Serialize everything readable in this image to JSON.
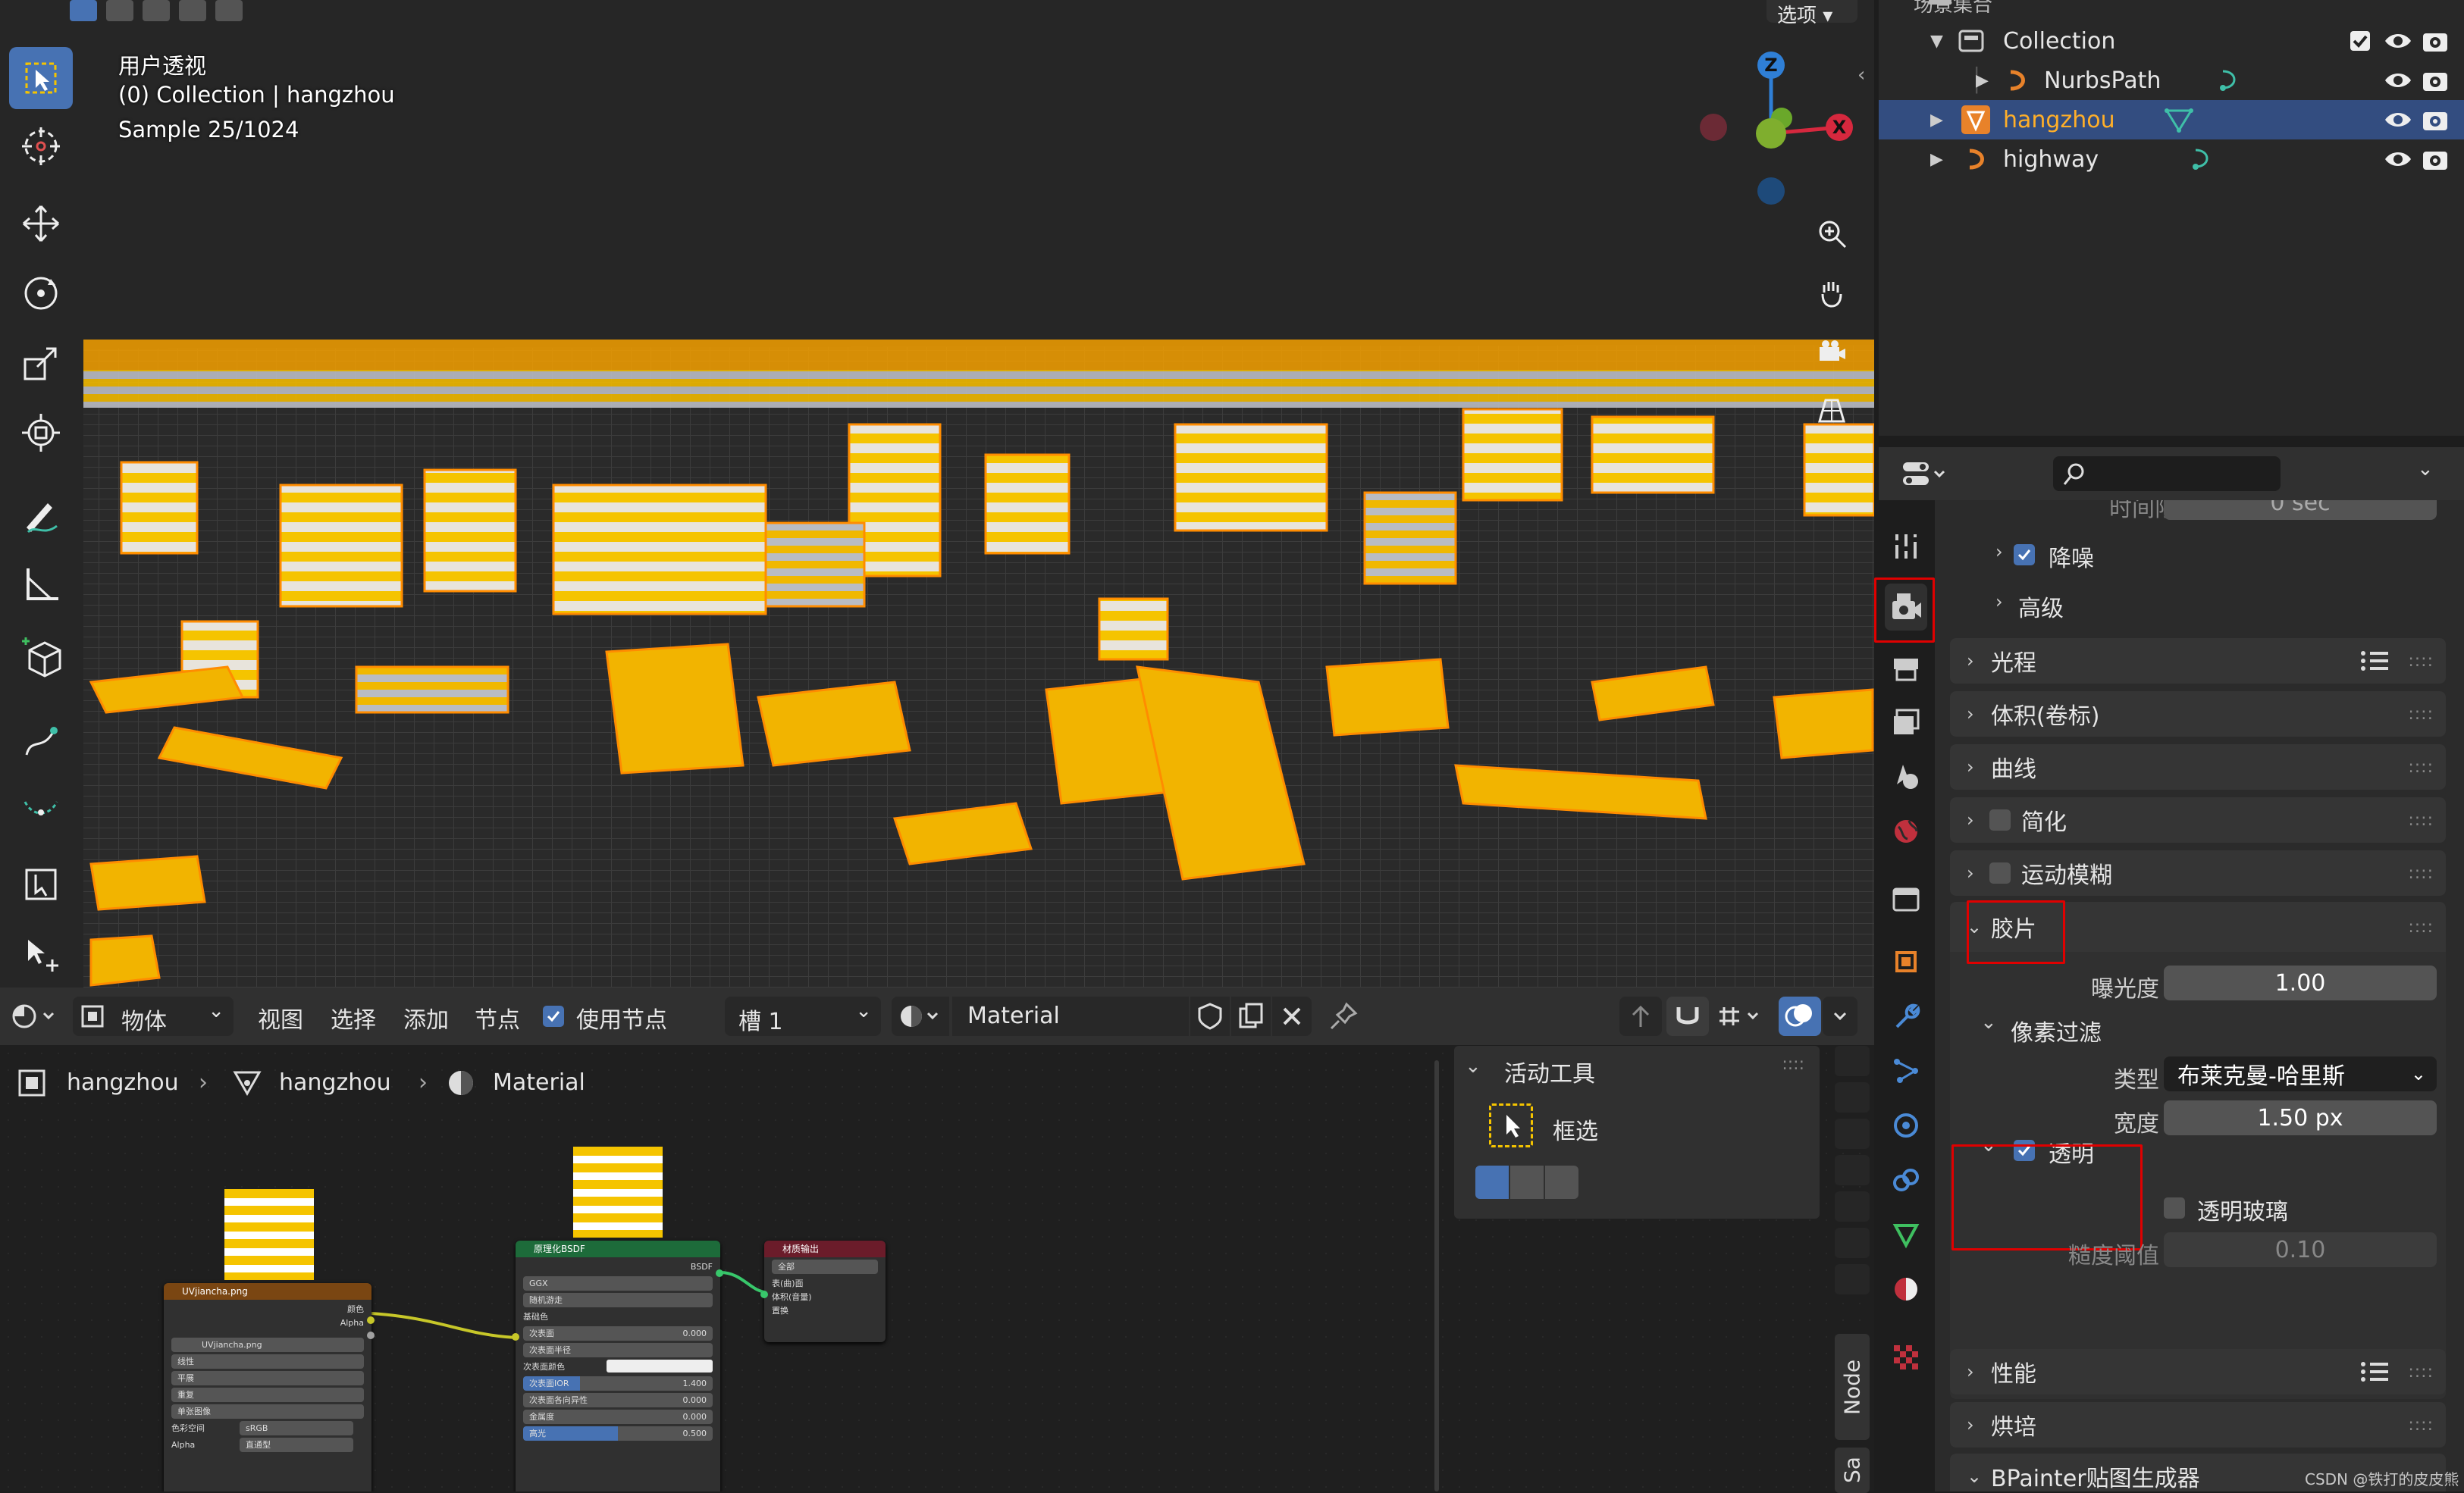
{
  "viewport": {
    "view_name": "用户透视",
    "collection_line": "(0) Collection | hangzhou",
    "sample": "Sample 25/1024",
    "options_label": "选项",
    "gizmo": {
      "z": "Z",
      "x": "X"
    }
  },
  "outliner": {
    "header": "场景集合",
    "rows": [
      {
        "name": "Collection"
      },
      {
        "name": "NurbsPath"
      },
      {
        "name": "hangzhou"
      },
      {
        "name": "highway"
      }
    ]
  },
  "properties": {
    "search_placeholder": "",
    "truncated_top": "时间限制",
    "truncated_value": "0 sec",
    "panels": {
      "denoise": "降噪",
      "advanced": "高级",
      "light_paths": "光程",
      "volumes": "体积(卷标)",
      "curves": "曲线",
      "simplify": "简化",
      "motion_blur": "运动模糊",
      "film": "胶片",
      "performance": "性能",
      "bake": "烘培",
      "bpainter": "BPainter贴图生成器"
    },
    "film": {
      "exposure_label": "曝光度",
      "exposure_value": "1.00",
      "pixel_filter": "像素过滤",
      "type_label": "类型",
      "type_value": "布莱克曼-哈里斯",
      "width_label": "宽度",
      "width_value": "1.50 px",
      "transparent": "透明",
      "transparent_glass": "透明玻璃",
      "roughness_label": "糙度阈值",
      "roughness_value": "0.10"
    }
  },
  "node_header": {
    "mode": "物体",
    "menus": [
      "视图",
      "选择",
      "添加",
      "节点"
    ],
    "use_nodes": "使用节点",
    "slot": "槽 1",
    "material": "Material"
  },
  "breadcrumb": {
    "object": "hangzhou",
    "mesh": "hangzhou",
    "material": "Material"
  },
  "side_panel": {
    "title": "活动工具",
    "tool": "框选"
  },
  "vertical_tabs": [
    "Node",
    "Sa"
  ],
  "nodes": {
    "image": {
      "title": "UVjiancha.png",
      "out_color": "颜色",
      "out_alpha": "Alpha",
      "img_name": "UVjiancha.png",
      "interp": "线性",
      "proj": "平展",
      "ext": "重复",
      "source": "单张图像",
      "colorspace_label": "色彩空间",
      "colorspace": "sRGB",
      "alpha_label": "Alpha",
      "alpha": "直通型"
    },
    "bsdf": {
      "title": "原理化BSDF",
      "out": "BSDF",
      "dist": "GGX",
      "sss": "随机游走",
      "rows": [
        {
          "label": "基础色",
          "value": ""
        },
        {
          "label": "次表面",
          "value": "0.000"
        },
        {
          "label": "次表面半径",
          "value": ""
        },
        {
          "label": "次表面颜色",
          "value": ""
        },
        {
          "label": "次表面IOR",
          "value": "1.400"
        },
        {
          "label": "次表面各向异性",
          "value": "0.000"
        },
        {
          "label": "金属度",
          "value": "0.000"
        },
        {
          "label": "高光",
          "value": "0.500"
        }
      ]
    },
    "output": {
      "title": "材质输出",
      "target": "全部",
      "rows": [
        "表(曲)面",
        "体积(音量)",
        "置换"
      ]
    }
  },
  "watermark": "CSDN @铁打的皮皮熊"
}
